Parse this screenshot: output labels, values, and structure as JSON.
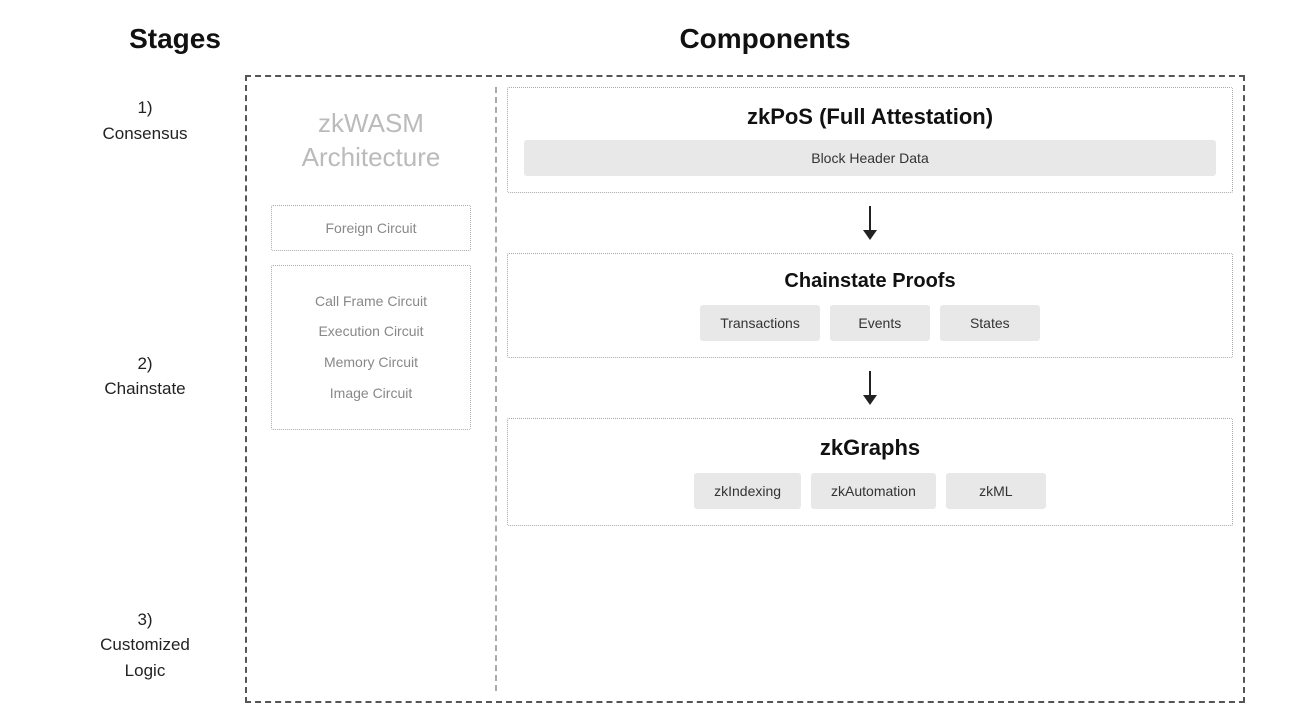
{
  "headers": {
    "stages": "Stages",
    "components": "Components"
  },
  "stages": [
    {
      "number": "1)",
      "label": "Consensus"
    },
    {
      "number": "2)",
      "label": "Chainstate"
    },
    {
      "number": "3)",
      "label": "Customized\nLogic"
    }
  ],
  "zkwasm": {
    "title": "zkWASM\nArchitecture",
    "foreign_circuit": "Foreign Circuit",
    "circuits": [
      "Call Frame Circuit",
      "Execution Circuit",
      "Memory Circuit",
      "Image Circuit"
    ]
  },
  "zkpos": {
    "title": "zkPoS (Full Attestation)",
    "block_header": "Block Header Data"
  },
  "chainstate": {
    "title": "Chainstate Proofs",
    "chips": [
      "Transactions",
      "Events",
      "States"
    ]
  },
  "zkgraphs": {
    "title": "zkGraphs",
    "chips": [
      "zkIndexing",
      "zkAutomation",
      "zkML"
    ]
  }
}
